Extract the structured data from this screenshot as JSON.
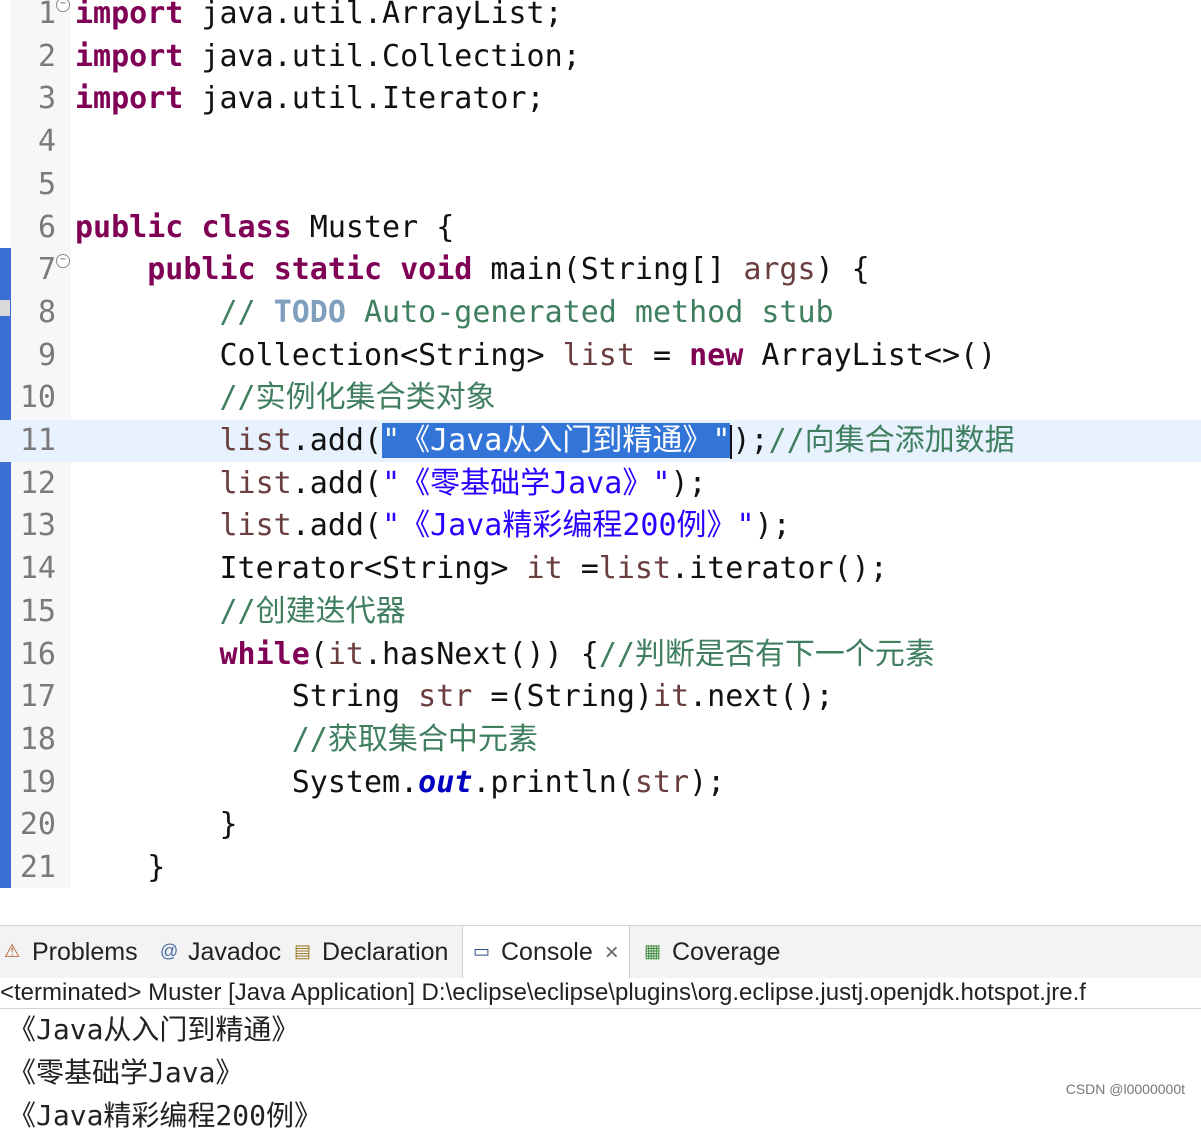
{
  "editor": {
    "lines": [
      {
        "n": "1",
        "fold": true,
        "segs": [
          {
            "t": "import",
            "c": "kw"
          },
          {
            "t": " java.util.ArrayList;"
          }
        ]
      },
      {
        "n": "2",
        "segs": [
          {
            "t": "import",
            "c": "kw"
          },
          {
            "t": " java.util.Collection;"
          }
        ]
      },
      {
        "n": "3",
        "segs": [
          {
            "t": "import",
            "c": "kw"
          },
          {
            "t": " java.util.Iterator;"
          }
        ]
      },
      {
        "n": "4",
        "segs": []
      },
      {
        "n": "5",
        "segs": []
      },
      {
        "n": "6",
        "segs": [
          {
            "t": "public",
            "c": "kw"
          },
          {
            "t": " "
          },
          {
            "t": "class",
            "c": "kw"
          },
          {
            "t": " Muster {"
          }
        ]
      },
      {
        "n": "7",
        "fold": true,
        "segs": [
          {
            "t": "    "
          },
          {
            "t": "public",
            "c": "kw"
          },
          {
            "t": " "
          },
          {
            "t": "static",
            "c": "kw"
          },
          {
            "t": " "
          },
          {
            "t": "void",
            "c": "kw"
          },
          {
            "t": " main(String[] "
          },
          {
            "t": "args",
            "c": "var"
          },
          {
            "t": ") {"
          }
        ]
      },
      {
        "n": "8",
        "segs": [
          {
            "t": "        // ",
            "c": "cm"
          },
          {
            "t": "TODO",
            "c": "todo"
          },
          {
            "t": " Auto-generated method stub",
            "c": "cm"
          }
        ]
      },
      {
        "n": "9",
        "segs": [
          {
            "t": "        Collection<String> "
          },
          {
            "t": "list",
            "c": "var"
          },
          {
            "t": " = "
          },
          {
            "t": "new",
            "c": "kw"
          },
          {
            "t": " ArrayList<>()"
          }
        ]
      },
      {
        "n": "10",
        "segs": [
          {
            "t": "        //实例化集合类对象",
            "c": "cm"
          }
        ]
      },
      {
        "n": "11",
        "current": true,
        "segs": [
          {
            "t": "        "
          },
          {
            "t": "list",
            "c": "var"
          },
          {
            "t": ".add("
          },
          {
            "t": "\"《Java从入门到精通》\"",
            "c": "sel"
          },
          {
            "caret": true
          },
          {
            "t": ");"
          },
          {
            "t": "//向集合添加数据",
            "c": "cm"
          }
        ]
      },
      {
        "n": "12",
        "segs": [
          {
            "t": "        "
          },
          {
            "t": "list",
            "c": "var"
          },
          {
            "t": ".add("
          },
          {
            "t": "\"《零基础学Java》\"",
            "c": "str"
          },
          {
            "t": ");"
          }
        ]
      },
      {
        "n": "13",
        "segs": [
          {
            "t": "        "
          },
          {
            "t": "list",
            "c": "var"
          },
          {
            "t": ".add("
          },
          {
            "t": "\"《Java精彩编程200例》\"",
            "c": "str"
          },
          {
            "t": ");"
          }
        ]
      },
      {
        "n": "14",
        "segs": [
          {
            "t": "        Iterator<String> "
          },
          {
            "t": "it",
            "c": "var"
          },
          {
            "t": " ="
          },
          {
            "t": "list",
            "c": "var"
          },
          {
            "t": ".iterator();"
          }
        ]
      },
      {
        "n": "15",
        "segs": [
          {
            "t": "        //创建迭代器",
            "c": "cm"
          }
        ]
      },
      {
        "n": "16",
        "segs": [
          {
            "t": "        "
          },
          {
            "t": "while",
            "c": "kw"
          },
          {
            "t": "("
          },
          {
            "t": "it",
            "c": "var"
          },
          {
            "t": ".hasNext()) {"
          },
          {
            "t": "//判断是否有下一个元素",
            "c": "cm"
          }
        ]
      },
      {
        "n": "17",
        "segs": [
          {
            "t": "            String "
          },
          {
            "t": "str",
            "c": "var"
          },
          {
            "t": " =(String)"
          },
          {
            "t": "it",
            "c": "var"
          },
          {
            "t": ".next();"
          }
        ]
      },
      {
        "n": "18",
        "segs": [
          {
            "t": "            //获取集合中元素",
            "c": "cm"
          }
        ]
      },
      {
        "n": "19",
        "segs": [
          {
            "t": "            System."
          },
          {
            "t": "out",
            "c": "fld"
          },
          {
            "t": ".println("
          },
          {
            "t": "str",
            "c": "var"
          },
          {
            "t": ");"
          }
        ]
      },
      {
        "n": "20",
        "segs": [
          {
            "t": "        }"
          }
        ]
      },
      {
        "n": "21",
        "segs": [
          {
            "t": "    }"
          }
        ]
      }
    ]
  },
  "bottom_panel": {
    "tabs": [
      {
        "label": "Problems",
        "icon": "problems-icon",
        "active": false
      },
      {
        "label": "Javadoc",
        "icon": "javadoc-icon",
        "active": false
      },
      {
        "label": "Declaration",
        "icon": "declaration-icon",
        "active": false
      },
      {
        "label": "Console",
        "icon": "console-icon",
        "active": true,
        "close": "×"
      },
      {
        "label": "Coverage",
        "icon": "coverage-icon",
        "active": false
      }
    ],
    "status": "<terminated> Muster [Java Application] D:\\eclipse\\eclipse\\plugins\\org.eclipse.justj.openjdk.hotspot.jre.f",
    "output": [
      "《Java从入门到精通》",
      "《零基础学Java》",
      "《Java精彩编程200例》"
    ]
  },
  "watermark": "CSDN @l0000000t",
  "colors": {
    "keyword": "#7f0055",
    "comment": "#3f7f5f",
    "string": "#2a00ff",
    "selection": "#3374d8",
    "current_line": "#e8f2fe"
  }
}
